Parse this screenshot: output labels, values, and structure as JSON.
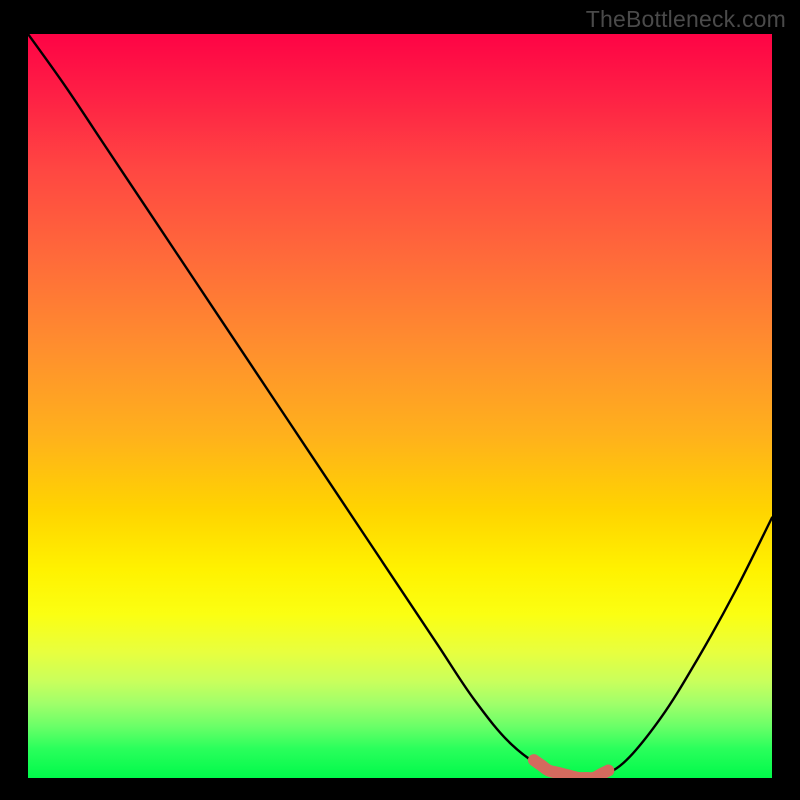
{
  "watermark": {
    "text": "TheBottleneck.com"
  },
  "colors": {
    "background": "#000000",
    "curve": "#000000",
    "accent_segment": "#d46a5e",
    "gradient_top": "#fe0345",
    "gradient_bottom": "#00f94a"
  },
  "chart_data": {
    "type": "line",
    "title": "",
    "xlabel": "",
    "ylabel": "",
    "xlim": [
      0,
      100
    ],
    "ylim": [
      0,
      100
    ],
    "x": [
      0,
      5,
      10,
      15,
      20,
      25,
      30,
      35,
      40,
      45,
      50,
      55,
      60,
      65,
      70,
      74,
      76,
      80,
      85,
      90,
      95,
      100
    ],
    "values": [
      100,
      93,
      85.5,
      78,
      70.5,
      63,
      55.5,
      48,
      40.5,
      33,
      25.5,
      18,
      10.5,
      4.5,
      1,
      0,
      0,
      2,
      8,
      16,
      25,
      35
    ],
    "accent_range_x": [
      68,
      78
    ],
    "notes": "V-shaped curve on vertical gradient; no axis ticks or numeric labels rendered; values are estimated from geometry with minimum near x≈74–76."
  }
}
